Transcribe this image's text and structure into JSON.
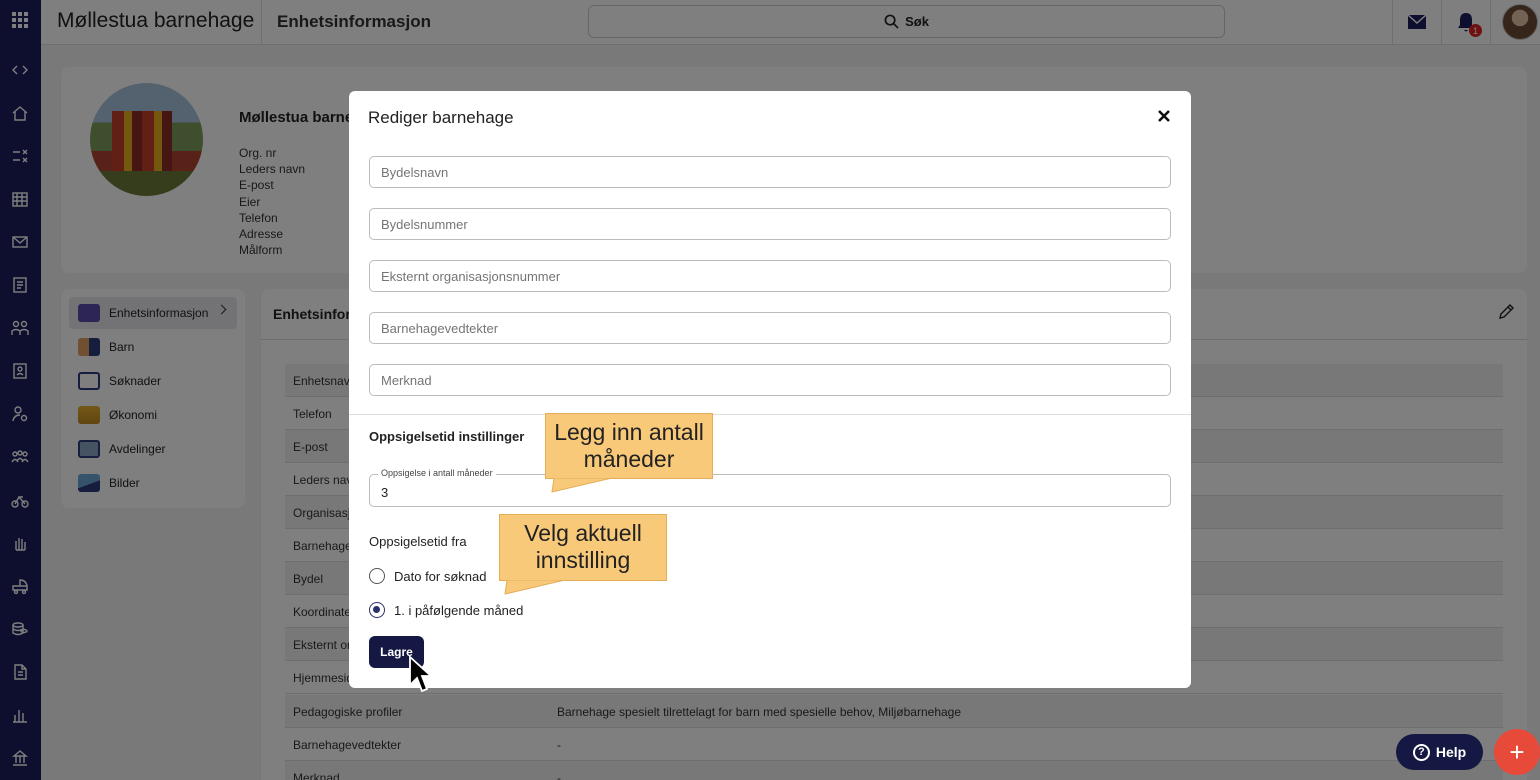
{
  "header": {
    "app_title": "Møllestua barnehage",
    "section_title": "Enhetsinformasjon",
    "search_label": "Søk",
    "notification_count": "1"
  },
  "profile": {
    "name": "Møllestua barne",
    "fields": [
      "Org. nr",
      "Leders navn",
      "E-post",
      "Eier",
      "Telefon",
      "Adresse",
      "Målform"
    ]
  },
  "menu": {
    "items": [
      {
        "label": "Enhetsinformasjon",
        "icon": "id-card-icon"
      },
      {
        "label": "Barn",
        "icon": "children-icon"
      },
      {
        "label": "Søknader",
        "icon": "clipboard-icon"
      },
      {
        "label": "Økonomi",
        "icon": "coins-icon"
      },
      {
        "label": "Avdelinger",
        "icon": "building-icon"
      },
      {
        "label": "Bilder",
        "icon": "image-icon"
      }
    ]
  },
  "info": {
    "title": "Enhetsinform",
    "rows": [
      {
        "label": "Enhetsnav",
        "value": ""
      },
      {
        "label": "Telefon",
        "value": ""
      },
      {
        "label": "E-post",
        "value": ""
      },
      {
        "label": "Leders navn",
        "value": ""
      },
      {
        "label": "Organisasjo",
        "value": ""
      },
      {
        "label": "Barnehage",
        "value": ""
      },
      {
        "label": "Bydel",
        "value": ""
      },
      {
        "label": "Koordinate",
        "value": ""
      },
      {
        "label": "Eksternt or",
        "value": ""
      },
      {
        "label": "Hjemmesid",
        "value": ""
      },
      {
        "label": "Pedagogiske profiler",
        "value": "Barnehage spesielt tilrettelagt for barn med spesielle behov, Miljøbarnehage"
      },
      {
        "label": "Barnehagevedtekter",
        "value": "-"
      },
      {
        "label": "Merknad",
        "value": "-"
      }
    ]
  },
  "modal": {
    "title": "Rediger barnehage",
    "fields": [
      {
        "placeholder": "Bydelsnavn"
      },
      {
        "placeholder": "Bydelsnummer"
      },
      {
        "placeholder": "Eksternt organisasjonsnummer"
      },
      {
        "placeholder": "Barnehagevedtekter"
      },
      {
        "placeholder": "Merknad"
      }
    ],
    "section_title": "Oppsigelsetid instillinger",
    "months_label": "Oppsigelse i antall måneder",
    "months_value": "3",
    "from_label": "Oppsigelsetid fra",
    "options": [
      {
        "label": "Dato for søknad",
        "selected": false
      },
      {
        "label": "1. i påfølgende måned",
        "selected": true
      }
    ],
    "save_label": "Lagre"
  },
  "callouts": {
    "months": "Legg inn antall måneder",
    "setting": "Velg aktuell innstilling"
  },
  "help_label": "Help",
  "colors": {
    "rail": "#1c1f5c",
    "primary_button": "#141842",
    "callout": "#f9c97a",
    "fab": "#e84a3a"
  }
}
